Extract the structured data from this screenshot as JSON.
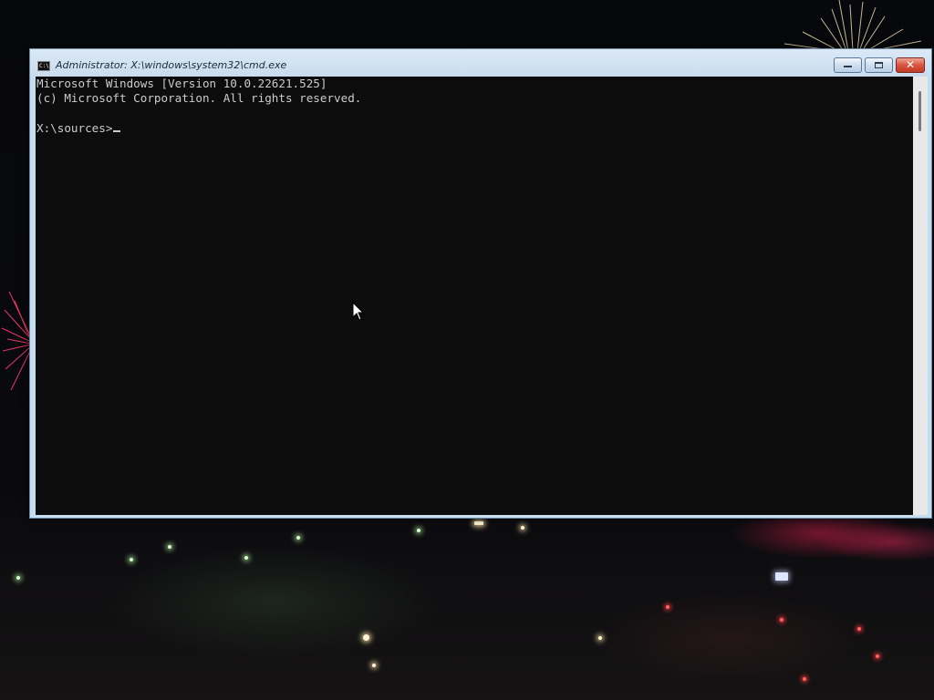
{
  "window": {
    "title": "Administrator: X:\\windows\\system32\\cmd.exe",
    "icon": "cmd-icon",
    "icon_label": "C:\\",
    "buttons": {
      "minimize": "minimize-icon",
      "maximize": "maximize-icon",
      "close": "close-icon",
      "close_glyph": "✕"
    }
  },
  "console": {
    "lines": [
      "Microsoft Windows [Version 10.0.22621.525]",
      "(c) Microsoft Corporation. All rights reserved.",
      "",
      "X:\\sources>"
    ],
    "text_color": "#cccccc",
    "background_color": "#0c0c0c"
  },
  "colors": {
    "titlebar": "#c9dcee",
    "close_button": "#c13b25",
    "desktop_bg": "#07080b"
  }
}
